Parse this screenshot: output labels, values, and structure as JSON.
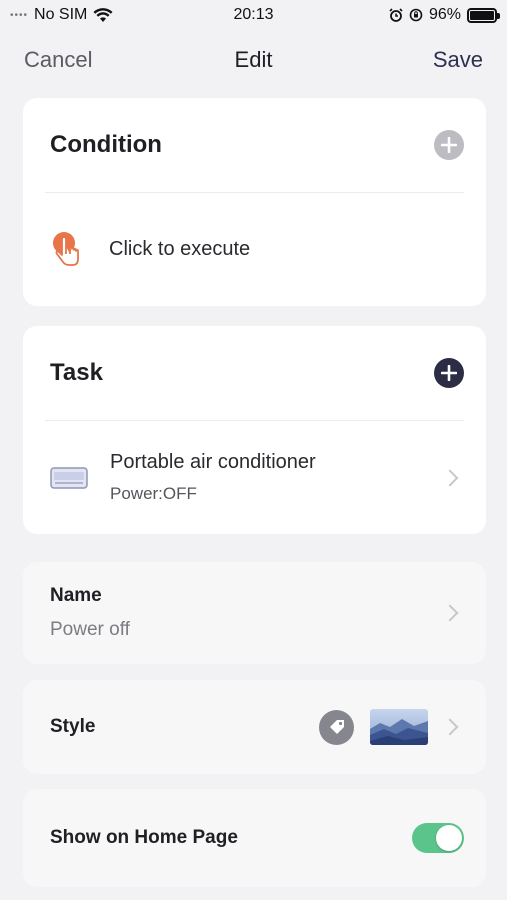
{
  "status_bar": {
    "signal_dots": "••••",
    "carrier": "No SIM",
    "time": "20:13",
    "battery": "96%",
    "icons": [
      "wifi-icon",
      "alarm-icon",
      "rotation-lock-icon",
      "battery-icon"
    ]
  },
  "nav": {
    "cancel": "Cancel",
    "title": "Edit",
    "save": "Save"
  },
  "condition": {
    "title": "Condition",
    "item_label": "Click to execute",
    "item_icon": "tap-hand-icon"
  },
  "task": {
    "title": "Task",
    "device_name": "Portable air conditioner",
    "device_state": "Power:OFF",
    "device_icon": "air-conditioner-icon"
  },
  "name_section": {
    "label": "Name",
    "value": "Power off"
  },
  "style_section": {
    "label": "Style"
  },
  "home_section": {
    "label": "Show on Home Page",
    "toggle_on": true
  },
  "colors": {
    "accent_dark": "#2c2d45",
    "toggle_green": "#5ac48b",
    "tap_orange": "#e8744a"
  }
}
